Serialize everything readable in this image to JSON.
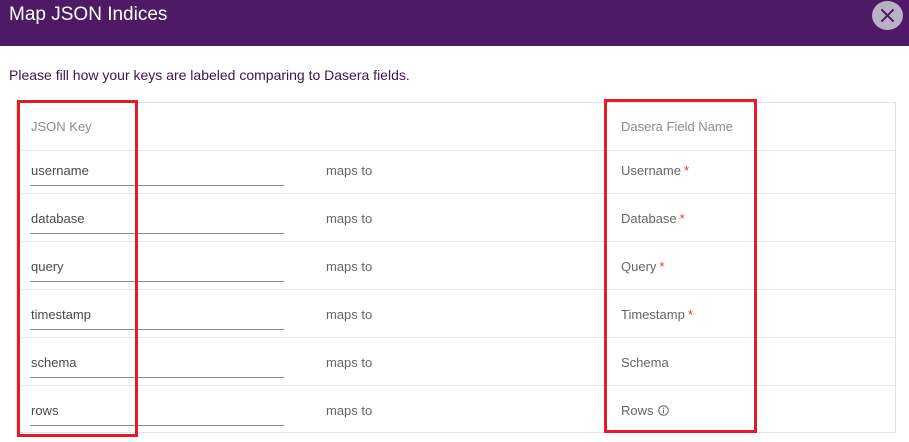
{
  "dialog": {
    "title": "Map JSON Indices",
    "instruction": "Please fill how your keys are labeled comparing to Dasera fields."
  },
  "table": {
    "key_header": "JSON Key",
    "field_header": "Dasera Field Name",
    "maps_label": "maps to",
    "rows": [
      {
        "key": "username",
        "field": "Username",
        "required": "*"
      },
      {
        "key": "database",
        "field": "Database",
        "required": "*"
      },
      {
        "key": "query",
        "field": "Query",
        "required": "*"
      },
      {
        "key": "timestamp",
        "field": "Timestamp",
        "required": "*"
      },
      {
        "key": "schema",
        "field": "Schema",
        "required": ""
      },
      {
        "key": "rows",
        "field": "Rows",
        "required": ""
      }
    ]
  },
  "icons": {
    "close": "close-icon",
    "info": "info-icon"
  },
  "colors": {
    "header_bg": "#4e1a66",
    "highlight": "#e31c2a",
    "required": "#e53935"
  }
}
